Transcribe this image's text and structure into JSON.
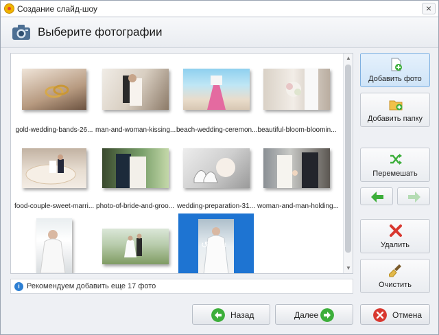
{
  "window": {
    "title": "Создание слайд-шоу",
    "close_glyph": "×"
  },
  "header": {
    "title": "Выберите фотографии",
    "icon": "camera-icon"
  },
  "gallery": {
    "photos": [
      {
        "caption": "gold-wedding-bands-26..."
      },
      {
        "caption": "man-and-woman-kissing..."
      },
      {
        "caption": "beach-wedding-ceremon..."
      },
      {
        "caption": "beautiful-bloom-bloomin..."
      },
      {
        "caption": "food-couple-sweet-marri..."
      },
      {
        "caption": "photo-of-bride-and-groo..."
      },
      {
        "caption": "wedding-preparation-31..."
      },
      {
        "caption": "woman-and-man-holding..."
      },
      {
        "caption": ""
      },
      {
        "caption": ""
      },
      {
        "caption": "",
        "selected": true
      }
    ],
    "scroll_up_glyph": "▲",
    "scroll_down_glyph": "▼",
    "rotate_glyph": "↺",
    "crop_glyph": "⌗"
  },
  "hint": {
    "text": "Рекомендуем добавить еще 17 фото",
    "icon_glyph": "i"
  },
  "sidebar": {
    "add_photo": "Добавить фото",
    "add_folder": "Добавить папку",
    "shuffle": "Перемешать",
    "delete": "Удалить",
    "clear": "Очистить"
  },
  "footer": {
    "back": "Назад",
    "next": "Далее",
    "cancel": "Отмена"
  },
  "colors": {
    "accent": "#1e74d2",
    "green": "#3cae3a",
    "red": "#d8372f"
  }
}
